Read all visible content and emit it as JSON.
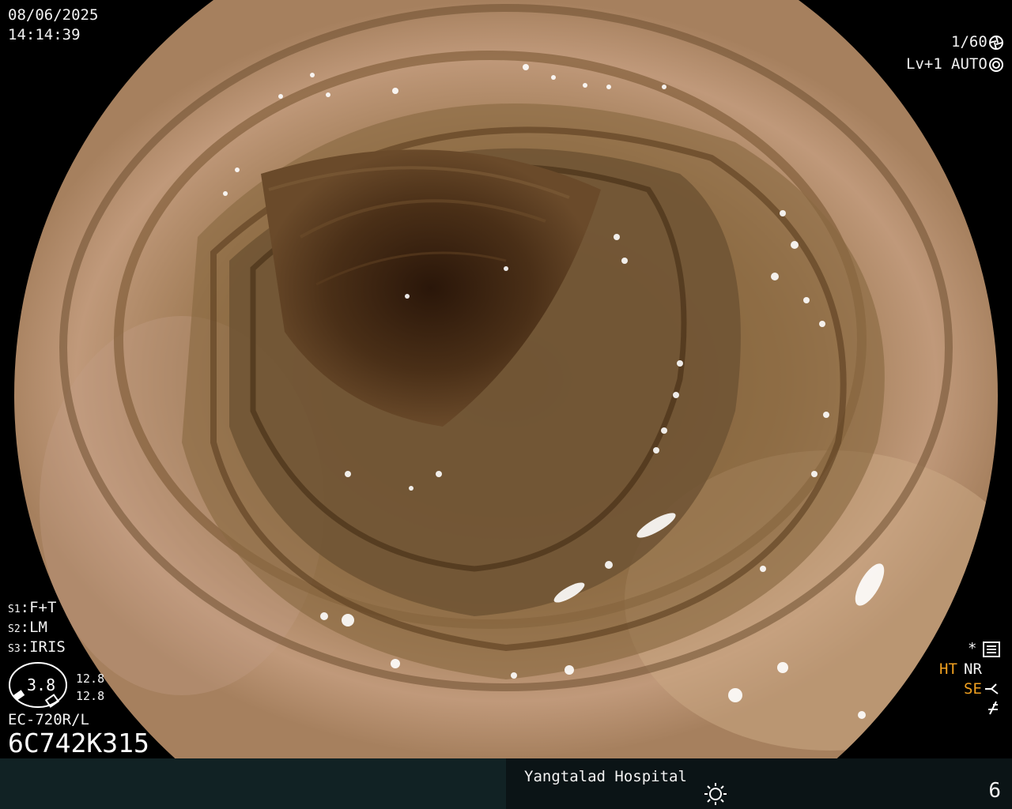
{
  "datetime": {
    "date": "08/06/2025",
    "time": "14:14:39"
  },
  "top_right": {
    "shutter": "1/60",
    "level": "Lv+1",
    "iris_mode": "AUTO"
  },
  "left_panel": {
    "s1": {
      "key": "S1",
      "value": "F+T"
    },
    "s2": {
      "key": "S2",
      "value": "LM"
    },
    "s3": {
      "key": "S3",
      "value": "IRIS"
    },
    "gauge_value": "3.8",
    "gauge_top": "12.8",
    "gauge_bottom": "12.8",
    "scope_model": "EC-720R/L",
    "serial": "6C742K315"
  },
  "right_panel": {
    "ht": "HT",
    "nr": "NR",
    "se": "SE"
  },
  "status_bar": {
    "hospital": "Yangtalad Hospital",
    "page_number": "6"
  },
  "icons": [
    "shutter-icon",
    "iris-icon",
    "settings-icon",
    "sun-icon",
    "enhance-icon",
    "freeze-icon"
  ],
  "colors": {
    "accent_orange": "#f0a020",
    "bar_left": "#112224",
    "bar_right": "#0b1416"
  }
}
